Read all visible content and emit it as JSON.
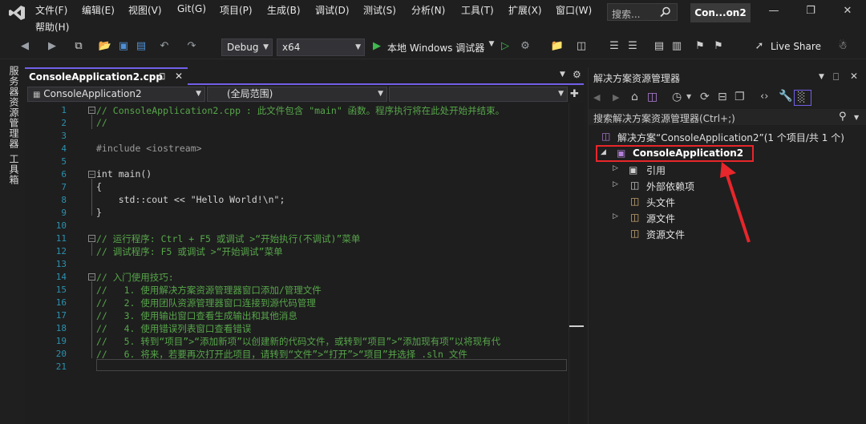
{
  "menu": {
    "items": [
      "文件(F)",
      "编辑(E)",
      "视图(V)",
      "Git(G)",
      "项目(P)",
      "生成(B)",
      "调试(D)",
      "测试(S)",
      "分析(N)",
      "工具(T)",
      "扩展(X)",
      "窗口(W)",
      "帮助(H)"
    ],
    "search_placeholder": "搜索...",
    "window_title": "Con...on2"
  },
  "toolbar": {
    "config": "Debug",
    "platform": "x64",
    "run_label": "本地 Windows 调试器",
    "live_share": "Live Share"
  },
  "side_strip": {
    "server_explorer": "服务器资源管理器",
    "toolbox": "工具箱"
  },
  "editor": {
    "tab_label": "ConsoleApplication2.cpp",
    "nav_project": "ConsoleApplication2",
    "nav_scope": "(全局范围)",
    "line_numbers": [
      "1",
      "2",
      "3",
      "4",
      "5",
      "6",
      "7",
      "8",
      "9",
      "10",
      "11",
      "12",
      "13",
      "14",
      "15",
      "16",
      "17",
      "18",
      "19",
      "20",
      "21"
    ],
    "lines": [
      "// ConsoleApplication2.cpp : 此文件包含 \"main\" 函数。程序执行将在此处开始并结束。",
      "//",
      "",
      "#include <iostream>",
      "",
      "int main()",
      "{",
      "    std::cout << \"Hello World!\\n\";",
      "}",
      "",
      "// 运行程序: Ctrl + F5 或调试 >“开始执行(不调试)”菜单",
      "// 调试程序: F5 或调试 >“开始调试”菜单",
      "",
      "// 入门使用技巧:",
      "//   1. 使用解决方案资源管理器窗口添加/管理文件",
      "//   2. 使用团队资源管理器窗口连接到源代码管理",
      "//   3. 使用输出窗口查看生成输出和其他消息",
      "//   4. 使用错误列表窗口查看错误",
      "//   5. 转到“项目”>“添加新项”以创建新的代码文件，或转到“项目”>“添加现有项”以将现有代",
      "//   6. 将来，若要再次打开此项目，请转到“文件”>“打开”>“项目”并选择 .sln 文件",
      ""
    ]
  },
  "solution_explorer": {
    "title": "解决方案资源管理器",
    "search_placeholder": "搜索解决方案资源管理器(Ctrl+;)",
    "solution_label": "解决方案“ConsoleApplication2”(1 个项目/共 1 个)",
    "project_label": "ConsoleApplication2",
    "nodes": [
      "引用",
      "外部依赖项",
      "头文件",
      "源文件",
      "资源文件"
    ]
  },
  "colors": {
    "accent": "#7160e8",
    "annotation": "#e8262b"
  }
}
